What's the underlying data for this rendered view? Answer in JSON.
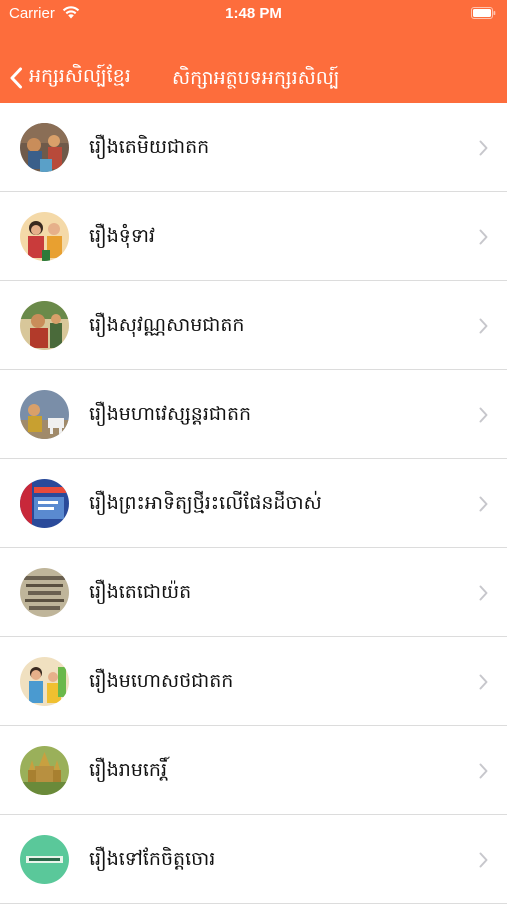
{
  "status_bar": {
    "carrier": "Carrier",
    "time": "1:48 PM"
  },
  "nav": {
    "back_label": "អក្សរសិល្ប៍ខ្មែរ",
    "title": "សិក្សាអត្ថបទអក្សរសិល្ប៍"
  },
  "colors": {
    "accent": "#fd6d3c",
    "separator": "#dcdcdc",
    "chevron": "#c7c7cc"
  },
  "items": [
    {
      "label": "រឿងតេមិយជាតក",
      "thumbnail": "story-thumbnail"
    },
    {
      "label": "រឿងទុំទាវ",
      "thumbnail": "story-thumbnail"
    },
    {
      "label": "រឿងសុវណ្ណសាមជាតក",
      "thumbnail": "story-thumbnail"
    },
    {
      "label": "រឿងមហាវេស្សន្តរជាតក",
      "thumbnail": "story-thumbnail"
    },
    {
      "label": "រឿងព្រះអាទិត្យថ្មីរះលើផែនដីចាស់",
      "thumbnail": "book-cover-thumbnail"
    },
    {
      "label": "រឿងតេជោយ៉ត",
      "thumbnail": "story-thumbnail"
    },
    {
      "label": "រឿងមហោសថជាតក",
      "thumbnail": "story-thumbnail"
    },
    {
      "label": "រឿងរាមកេរ្តិ៍",
      "thumbnail": "temple-thumbnail"
    },
    {
      "label": "រឿងទៅកែចិត្តចោរ",
      "thumbnail": "book-cover-thumbnail"
    }
  ]
}
